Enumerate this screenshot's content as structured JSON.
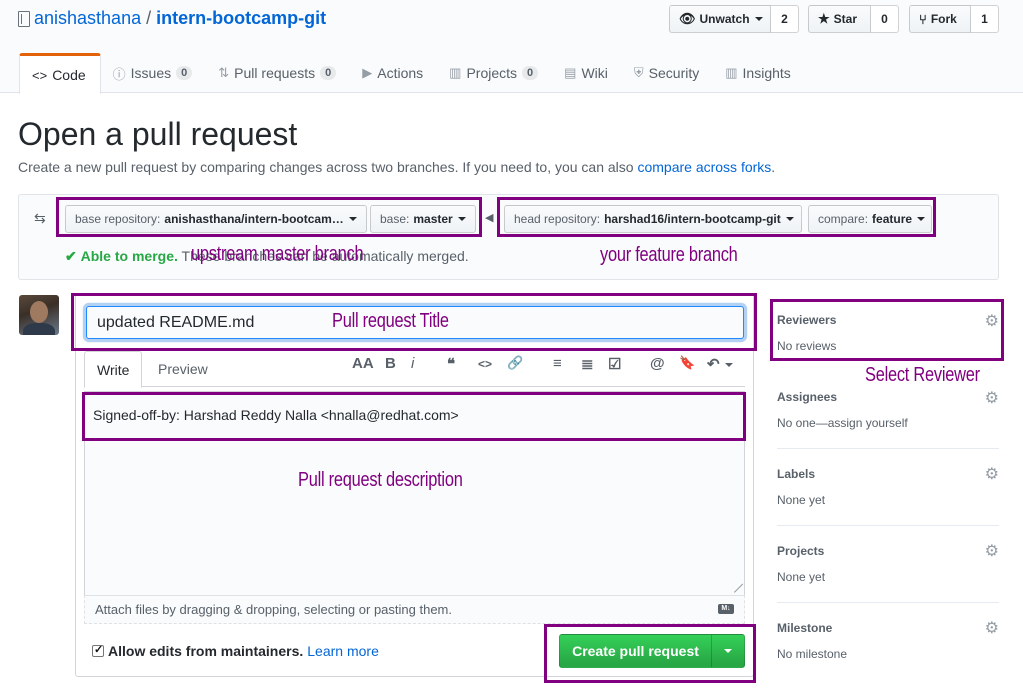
{
  "repo": {
    "owner": "anishasthana",
    "separator": "/",
    "name": "intern-bootcamp-git"
  },
  "actions": {
    "watch": {
      "label": "Unwatch",
      "count": "2"
    },
    "star": {
      "label": "Star",
      "count": "0"
    },
    "fork": {
      "label": "Fork",
      "count": "1"
    }
  },
  "nav": {
    "code": "Code",
    "issues": "Issues",
    "issues_count": "0",
    "pulls": "Pull requests",
    "pulls_count": "0",
    "actions": "Actions",
    "projects": "Projects",
    "projects_count": "0",
    "wiki": "Wiki",
    "security": "Security",
    "insights": "Insights"
  },
  "page": {
    "title": "Open a pull request",
    "description": "Create a new pull request by comparing changes across two branches. If you need to, you can also ",
    "description_link": "compare across forks",
    "description_end": "."
  },
  "compare": {
    "base_repo_label": "base repository:",
    "base_repo_value": "anishasthana/intern-bootcam…",
    "base_label": "base:",
    "base_value": "master",
    "head_repo_label": "head repository:",
    "head_repo_value": "harshad16/intern-bootcamp-git",
    "compare_label": "compare:",
    "compare_value": "feature",
    "merge_ok": "Able to merge.",
    "merge_text": "These branches can be automatically merged."
  },
  "form": {
    "title_value": "updated README.md",
    "tab_write": "Write",
    "tab_preview": "Preview",
    "body_value": "Signed-off-by: Harshad Reddy Nalla <hnalla@redhat.com>",
    "attach_hint": "Attach files by dragging & dropping, selecting or pasting them.",
    "allow_edits": "Allow edits from maintainers.",
    "learn_more": "Learn more",
    "submit_label": "Create pull request",
    "toolbar": [
      "AA",
      "B",
      "i",
      "❝",
      "<>",
      "🔗",
      "≡",
      "≣",
      "☑",
      "@",
      "🔖",
      "↶"
    ]
  },
  "sidebar": {
    "reviewers": {
      "heading": "Reviewers",
      "value": "No reviews"
    },
    "assignees": {
      "heading": "Assignees",
      "value": "No one—assign yourself"
    },
    "labels": {
      "heading": "Labels",
      "value": "None yet"
    },
    "projects": {
      "heading": "Projects",
      "value": "None yet"
    },
    "milestone": {
      "heading": "Milestone",
      "value": "No milestone"
    }
  },
  "annotations": {
    "upstream": "upstream master branch",
    "feature": "your feature branch",
    "title": "Pull request Title",
    "reviewer": "Select Reviewer",
    "description": "Pull request description"
  },
  "colors": {
    "annotation": "#800080",
    "primary_button": "#28a745",
    "link": "#0366d6",
    "active_tab_border": "#e36209"
  }
}
